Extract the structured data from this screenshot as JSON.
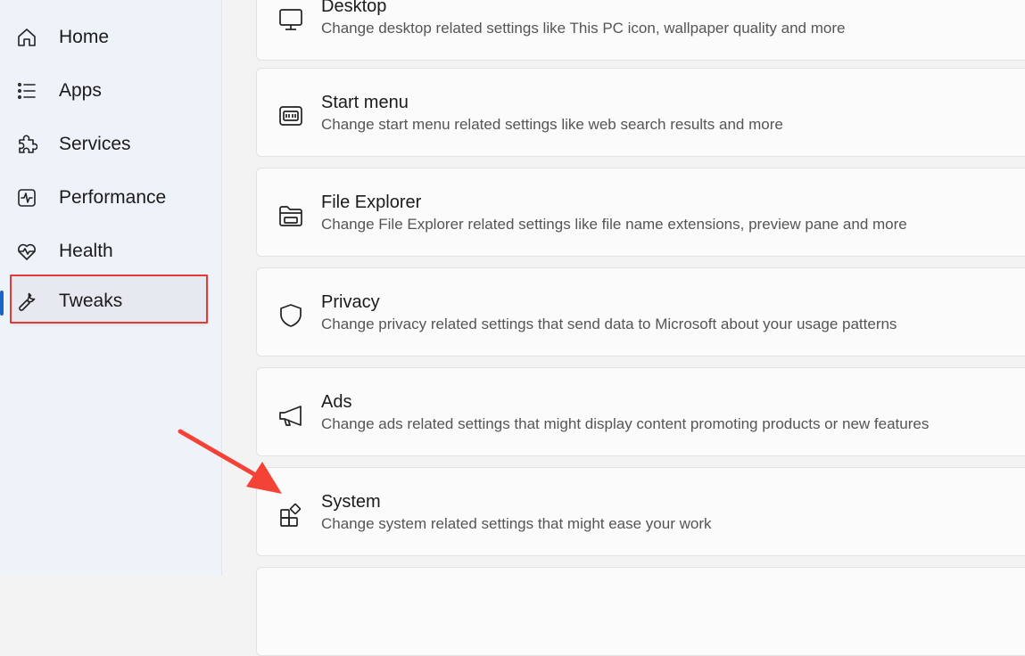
{
  "sidebar": {
    "items": [
      {
        "label": "Home",
        "icon": "home-icon"
      },
      {
        "label": "Apps",
        "icon": "list-icon"
      },
      {
        "label": "Services",
        "icon": "puzzle-icon"
      },
      {
        "label": "Performance",
        "icon": "activity-icon"
      },
      {
        "label": "Health",
        "icon": "heart-pulse-icon"
      },
      {
        "label": "Tweaks",
        "icon": "wrench-icon"
      }
    ],
    "selected": "Tweaks"
  },
  "cards": [
    {
      "title": "Desktop",
      "description": "Change desktop related settings like This PC icon, wallpaper quality and more",
      "icon": "monitor-icon"
    },
    {
      "title": "Start menu",
      "description": "Change start menu related settings like web search results and more",
      "icon": "start-menu-icon"
    },
    {
      "title": "File Explorer",
      "description": "Change File Explorer related settings like file name extensions, preview pane and more",
      "icon": "folder-icon"
    },
    {
      "title": "Privacy",
      "description": "Change privacy related settings that send data to Microsoft about your usage patterns",
      "icon": "shield-icon"
    },
    {
      "title": "Ads",
      "description": "Change ads related settings that might display content promoting products or new features",
      "icon": "megaphone-icon"
    },
    {
      "title": "System",
      "description": "Change system related settings that might ease your work",
      "icon": "system-apps-icon"
    }
  ],
  "annotation": {
    "highlight_color": "#e53935",
    "arrow_color": "#f44336"
  },
  "accent": "#1a66c8"
}
